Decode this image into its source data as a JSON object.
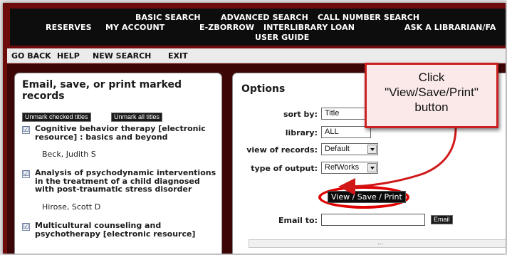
{
  "topnav": {
    "basic_search": "BASIC SEARCH",
    "advanced_search": "ADVANCED SEARCH",
    "call_number_search": "CALL NUMBER SEARCH",
    "reserves": "RESERVES",
    "my_account": "MY ACCOUNT",
    "ezborrow": "E-ZBORROW",
    "interlibrary_loan": "INTERLIBRARY LOAN",
    "ask_librarian": "ASK A LIBRARIAN/FA",
    "user_guide": "USER GUIDE"
  },
  "toolbar": {
    "go_back": "GO BACK",
    "help": "HELP",
    "new_search": "NEW SEARCH",
    "exit": "EXIT"
  },
  "left_panel": {
    "title": "Email, save, or print marked records",
    "unmark_checked": "Unmark checked titles",
    "unmark_all": "Unmark all titles",
    "records": [
      {
        "checked": "☑",
        "title": "Cognitive behavior therapy [electronic resource] : basics and beyond",
        "author": "Beck, Judith S"
      },
      {
        "checked": "☑",
        "title": "Analysis of psychodynamic interventions in the treatment of a child diagnosed with post-traumatic stress disorder",
        "author": "Hirose, Scott D"
      },
      {
        "checked": "☑",
        "title": "Multicultural counseling and psychotherapy [electronic resource]",
        "author": ""
      }
    ]
  },
  "options": {
    "title": "Options",
    "sort_by_label": "sort by:",
    "sort_by_value": "Title",
    "library_label": "library:",
    "library_value": "ALL",
    "view_records_label": "view of records:",
    "view_records_value": "Default",
    "type_output_label": "type of output:",
    "type_output_value": "RefWorks",
    "view_save_print": "View / Save / Print",
    "email_to_label": "Email to:",
    "email_to_value": "",
    "email_button": "Email",
    "bottom_bar_text": "..."
  },
  "callout": {
    "line1": "Click",
    "line2": "\"View/Save/Print\"",
    "line3": "button"
  },
  "colors": {
    "frame": "#6e0b0b",
    "nav_bg": "#0d0d0d",
    "callout_border": "#cc2020",
    "highlight_ellipse": "#e00000"
  }
}
